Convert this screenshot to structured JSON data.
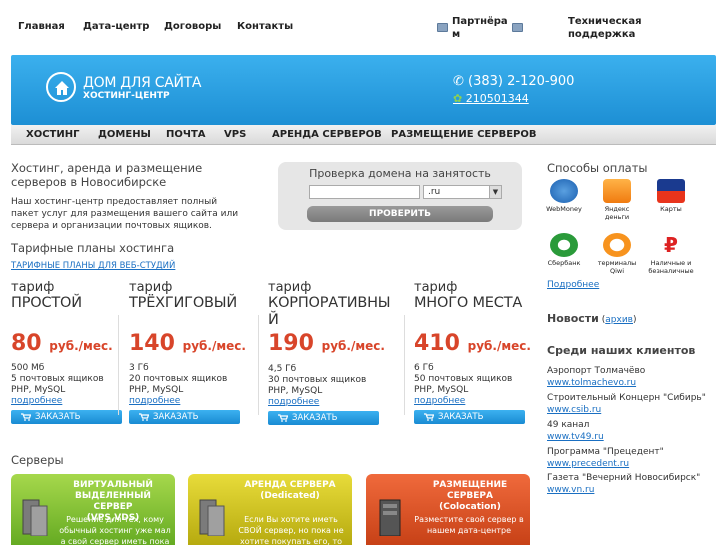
{
  "topnav": {
    "items": [
      "Главная",
      "Дата-центр",
      "Договоры",
      "Контакты"
    ],
    "partners_label_1": "Партнёра",
    "partners_label_2": "м",
    "support_label_1": "Техническая",
    "support_label_2": "поддержка"
  },
  "banner": {
    "brand_title": "ДОМ ДЛЯ САЙТА",
    "brand_subtitle": "ХОСТИНГ-ЦЕНТР",
    "phone": "(383) 2-120-900",
    "icq": "210501344",
    "colors": {
      "accent": "#2fa3e3",
      "price": "#d8452a"
    }
  },
  "menu": [
    "ХОСТИНГ",
    "ДОМЕНЫ",
    "ПОЧТА",
    "VPS",
    "АРЕНДА СЕРВЕРОВ",
    "РАЗМЕЩЕНИЕ СЕРВЕРОВ"
  ],
  "main": {
    "title_1": "Хостинг, аренда и размещение",
    "title_2": "серверов в Новосибирске",
    "desc_1": "Наш хостинг-центр предоставляет полный",
    "desc_2": "пакет услуг для размещения вашего сайта или",
    "desc_3": "сервера и организации почтовых ящиков.",
    "tariffs_heading": "Тарифные планы хостинга",
    "studio_link": "ТАРИФНЫЕ ПЛАНЫ ДЛЯ ВЕБ-СТУДИЙ"
  },
  "domain_check": {
    "title": "Проверка домена на занятость",
    "input_value": "",
    "zone": ".ru",
    "button": "ПРОВЕРИТЬ"
  },
  "tariffs": [
    {
      "label": "тариф",
      "name_1": "ПРОСТОЙ",
      "name_2": "",
      "price": "80",
      "unit": "руб./мес.",
      "disk": "500 Мб",
      "mail": "5 почтовых ящиков",
      "tech": "PHP, MySQL",
      "more": "подробнее",
      "order": "ЗАКАЗАТЬ"
    },
    {
      "label": "тариф",
      "name_1": "ТРЁХГИГОВЫЙ",
      "name_2": "",
      "price": "140",
      "unit": "руб./мес.",
      "disk": "3 Гб",
      "mail": "20 почтовых ящиков",
      "tech": "PHP, MySQL",
      "more": "подробнее",
      "order": "ЗАКАЗАТЬ"
    },
    {
      "label": "тариф",
      "name_1": "КОРПОРАТИВНЫ",
      "name_2": "Й",
      "price": "190",
      "unit": "руб./мес.",
      "disk": "4,5 Гб",
      "mail": "30 почтовых ящиков",
      "tech": "PHP, MySQL",
      "more": "подробнее",
      "order": "ЗАКАЗАТЬ"
    },
    {
      "label": "тариф",
      "name_1": "МНОГО МЕСТА",
      "name_2": "",
      "price": "410",
      "unit": "руб./мес.",
      "disk": "6 Гб",
      "mail": "50 почтовых ящиков",
      "tech": "PHP, MySQL",
      "more": "подробнее",
      "order": "ЗАКАЗАТЬ"
    }
  ],
  "servers": {
    "heading": "Серверы",
    "cards": [
      {
        "t1": "ВИРТУАЛЬНЫЙ",
        "t2": "ВЫДЕЛЕННЫЙ СЕРВЕР",
        "t3": "(VPS,VDS)",
        "d1": "Решение для тех, кому",
        "d2": "обычный хостинг уже мал",
        "d3": "а свой сервер иметь пока"
      },
      {
        "t1": "АРЕНДА СЕРВЕРА",
        "t2": "(Dedicated)",
        "t3": "",
        "d1": "Если Вы хотите иметь",
        "d2": "СВОЙ сервер, но пока не",
        "d3": "хотите покупать его, то"
      },
      {
        "t1": "РАЗМЕЩЕНИЕ СЕРВЕРА",
        "t2": "(Colocation)",
        "t3": "",
        "d1": "Разместите свой сервер в",
        "d2": "нашем дата-центре",
        "d3": ""
      }
    ]
  },
  "sidebar": {
    "payment_heading": "Способы оплаты",
    "payments": [
      {
        "l1": "WebMoney",
        "l2": "",
        "icon": "webmoney-icon"
      },
      {
        "l1": "Яндекс",
        "l2": "деньги",
        "icon": "yandex-money-icon"
      },
      {
        "l1": "VISA",
        "l2": "Карты",
        "icon": "visa-icon"
      },
      {
        "l1": "Сбербанк",
        "l2": "",
        "icon": "sberbank-icon"
      },
      {
        "l1": "терминалы",
        "l2": "Qiwi",
        "icon": "qiwi-icon"
      },
      {
        "l1": "Наличные и",
        "l2": "безналичные",
        "icon": "ruble-icon"
      }
    ],
    "payment_more": "Подробнее",
    "news_heading": "Новости",
    "news_archive": "архив",
    "clients_heading": "Среди наших клиентов",
    "clients": [
      {
        "name": "Аэропорт Толмачёво",
        "url": "www.tolmachevo.ru"
      },
      {
        "name": "Строительный Концерн \"Сибирь\"",
        "url": "www.csib.ru"
      },
      {
        "name": "49 канал",
        "url": "www.tv49.ru"
      },
      {
        "name": "Программа \"Прецедент\"",
        "url": "www.precedent.ru"
      },
      {
        "name": "Газета \"Вечерний Новосибирск\"",
        "url": "www.vn.ru"
      }
    ]
  }
}
